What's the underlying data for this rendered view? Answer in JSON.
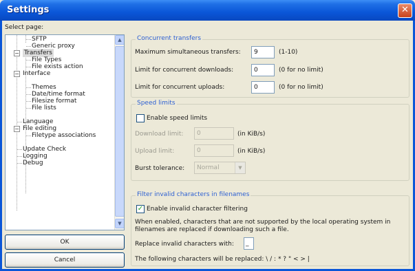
{
  "window": {
    "title": "Settings",
    "close_glyph": "✕"
  },
  "sidebar": {
    "label": "Select page:",
    "items": [
      {
        "label": "SFTP",
        "level": 2
      },
      {
        "label": "Generic proxy",
        "level": 2
      },
      {
        "label": "Transfers",
        "level": 1,
        "expander": "−",
        "selected": true
      },
      {
        "label": "File Types",
        "level": 2
      },
      {
        "label": "File exists action",
        "level": 2
      },
      {
        "label": "Interface",
        "level": 1,
        "expander": "−"
      },
      {
        "label": "Themes",
        "level": 2
      },
      {
        "label": "Date/time format",
        "level": 2
      },
      {
        "label": "Filesize format",
        "level": 2
      },
      {
        "label": "File lists",
        "level": 2
      },
      {
        "label": "Language",
        "level": 1
      },
      {
        "label": "File editing",
        "level": 1,
        "expander": "−"
      },
      {
        "label": "Filetype associations",
        "level": 2
      },
      {
        "label": "Update Check",
        "level": 1
      },
      {
        "label": "Logging",
        "level": 1
      },
      {
        "label": "Debug",
        "level": 1
      }
    ],
    "scroll_up": "▲",
    "scroll_down": "▼"
  },
  "buttons": {
    "ok": "OK",
    "cancel": "Cancel"
  },
  "concurrent": {
    "title": "Concurrent transfers",
    "max_label": "Maximum simultaneous transfers:",
    "max_value": "9",
    "max_hint": "(1-10)",
    "dl_label": "Limit for concurrent downloads:",
    "dl_value": "0",
    "dl_hint": "(0 for no limit)",
    "ul_label": "Limit for concurrent uploads:",
    "ul_value": "0",
    "ul_hint": "(0 for no limit)"
  },
  "speed": {
    "title": "Speed limits",
    "enable_label": "Enable speed limits",
    "enable_checked": false,
    "dl_label": "Download limit:",
    "dl_value": "0",
    "dl_unit": "(in KiB/s)",
    "ul_label": "Upload limit:",
    "ul_value": "0",
    "ul_unit": "(in KiB/s)",
    "burst_label": "Burst tolerance:",
    "burst_value": "Normal",
    "burst_arrow": "▼"
  },
  "filter": {
    "title": "Filter invalid characters in filenames",
    "enable_label": "Enable invalid character filtering",
    "enable_checked": true,
    "check_glyph": "✓",
    "desc_line1": "When enabled, characters that are not supported by the local operating system in",
    "desc_line2": "filenames are replaced if downloading such a file.",
    "replace_label": "Replace invalid characters with:",
    "replace_value": "_",
    "following_label": "The following characters will be replaced: \\ / : * ? \" < > |"
  }
}
